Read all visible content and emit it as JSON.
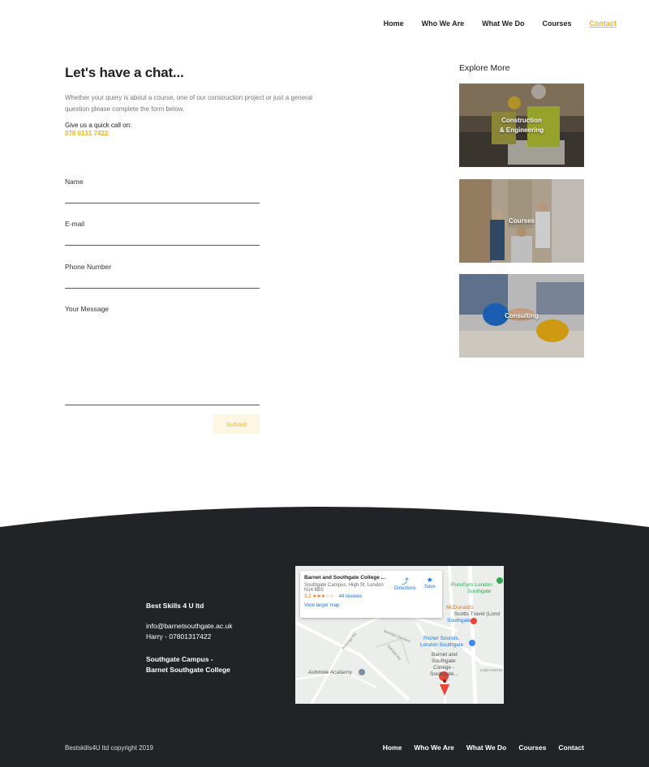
{
  "nav": {
    "items": [
      "Home",
      "Who We Are",
      "What We Do",
      "Courses",
      "Contact"
    ],
    "active": "Contact",
    "accent": "#f5b320"
  },
  "contact": {
    "title": "Let's have a chat...",
    "intro": "Whether your query is about a course, one of our construction project or just a general question please complete the form below.",
    "call_heading": "Give us a quick call on:",
    "phone": "078 0131 7422"
  },
  "form": {
    "name_label": "Name",
    "email_label": "E-mail",
    "phone_label": "Phone Number",
    "message_label": "Your Message",
    "submit_label": "Submit"
  },
  "explore": {
    "heading": "Explore More",
    "cards": [
      {
        "line1": "Construction",
        "line2": "& Engineering"
      },
      {
        "line1": "Courses",
        "line2": ""
      },
      {
        "line1": "Consulting",
        "line2": ""
      }
    ]
  },
  "footer": {
    "company": "Best Skills 4 U ltd",
    "email": "info@barnetsouthgate.ac.uk",
    "contact": "Harry - 07801317422",
    "campus_line1": "Southgate Campus -",
    "campus_line2": "Barnet Southgate College",
    "copyright": "Bestskills4U ltd copyright 2019",
    "nav": [
      "Home",
      "Who We Are",
      "What We Do",
      "Courses",
      "Contact"
    ],
    "bg_color": "#222326"
  },
  "map": {
    "place_title": "Barnet and Southgate College ...",
    "address_line1": "Southgate Campus, High St, London",
    "address_line2": "N14 6BS",
    "rating": "3.2",
    "stars": "★★★☆☆",
    "reviews": "44 reviews",
    "directions": "Directions",
    "save": "Save",
    "larger": "View larger map",
    "labels": {
      "puregym": "PureGym London",
      "puregym2": "Southgate",
      "mcdonalds": "McDonald's",
      "scotts": "Scotts Travel (Lond",
      "southgate": "Southgate",
      "richer1": "Richer Sounds,",
      "richer2": "London Southgate",
      "college1": "Barnet and",
      "college2": "Southgate",
      "college3": "College -",
      "college4": "Southgate...",
      "ashmole": "Ashmole Academy",
      "burleigh": "Burleigh Gardens",
      "ashridge": "Ashridge Rd",
      "oakfield": "Oakfield Rd",
      "leigh": "Leigh Hunt Dr"
    }
  }
}
